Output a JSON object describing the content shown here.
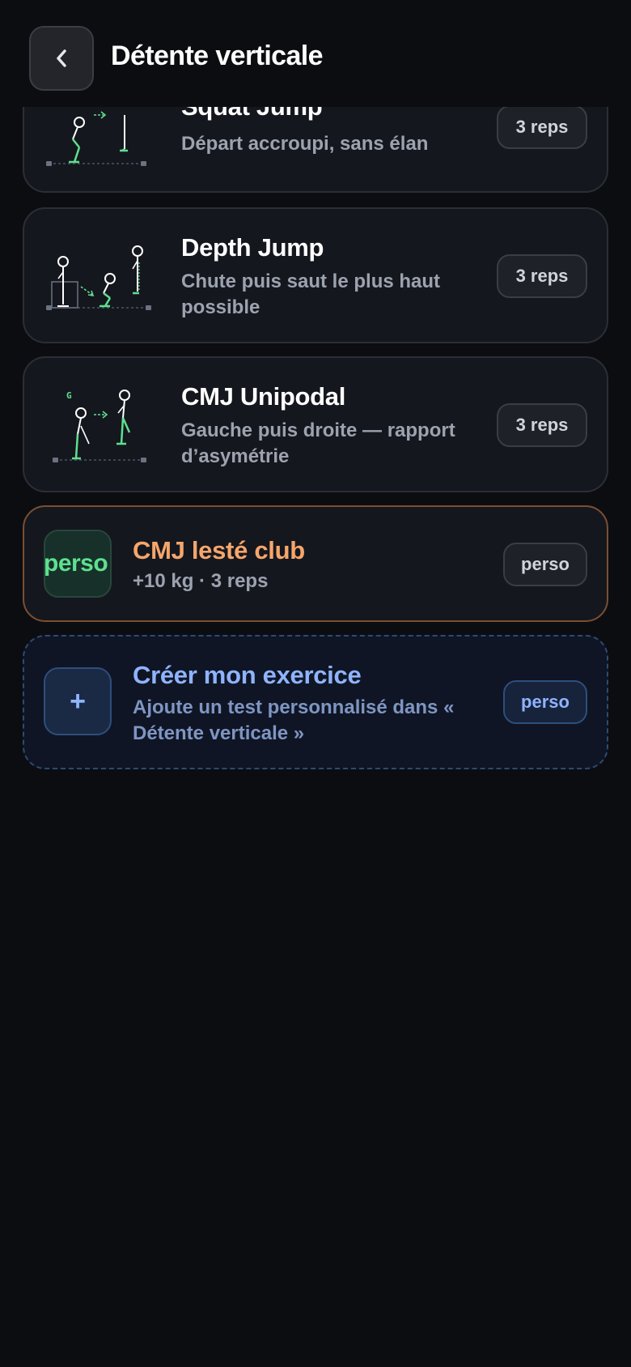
{
  "header": {
    "title": "Détente verticale"
  },
  "cards": [
    {
      "title": "Squat Jump",
      "subtitle": "Départ accroupi, sans élan",
      "badge": "3 reps"
    },
    {
      "title": "Depth Jump",
      "subtitle": "Chute puis saut le plus haut possible",
      "badge": "3 reps"
    },
    {
      "title": "CMJ Unipodal",
      "subtitle": "Gauche puis droite — rapport d’asymétrie",
      "badge": "3 reps",
      "figure_label": "G"
    }
  ],
  "custom": {
    "icon_text": "perso",
    "title": "CMJ lesté club",
    "subtitle": "+10 kg · 3 reps",
    "badge": "perso"
  },
  "create": {
    "icon": "+",
    "title": "Créer mon exercice",
    "subtitle": "Ajoute un test personnalisé dans « Détente verticale »",
    "badge": "perso"
  },
  "colors": {
    "background": "#0c0d11",
    "card": "#15171e",
    "figure_green": "#5ee08f",
    "accent_orange": "#f6a66b",
    "accent_blue": "#8fb3ff"
  }
}
